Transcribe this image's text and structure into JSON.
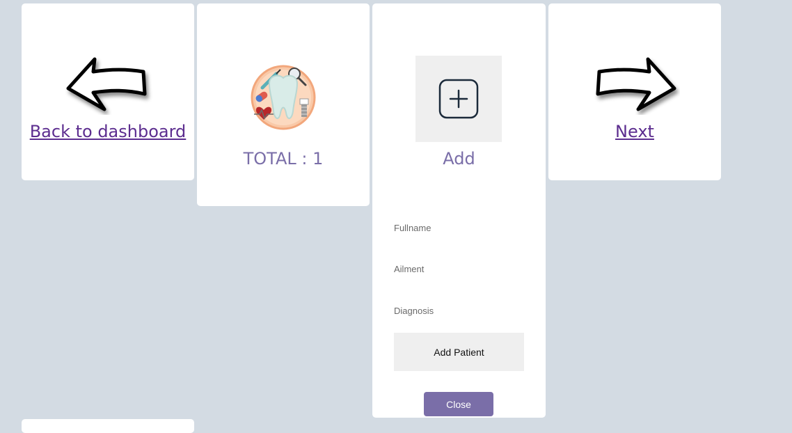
{
  "back_card": {
    "icon": "arrow-left-icon",
    "link_label": "Back to dashboard"
  },
  "total_card": {
    "icon": "tooth-icon",
    "title": "TOTAL : 1"
  },
  "add_card": {
    "icon": "plus-square-icon",
    "title": "Add",
    "fields": {
      "fullname_placeholder": "Fullname",
      "ailment_placeholder": "Ailment",
      "diagnosis_placeholder": "Diagnosis"
    },
    "submit_label": "Add Patient",
    "close_label": "Close"
  },
  "next_card": {
    "icon": "arrow-right-icon",
    "link_label": "Next"
  },
  "colors": {
    "background": "#d3dbe3",
    "card": "#ffffff",
    "link": "#5c2d8f",
    "title": "#7a6ea8",
    "close_button": "#7a6ea8",
    "tile": "#efefef"
  }
}
